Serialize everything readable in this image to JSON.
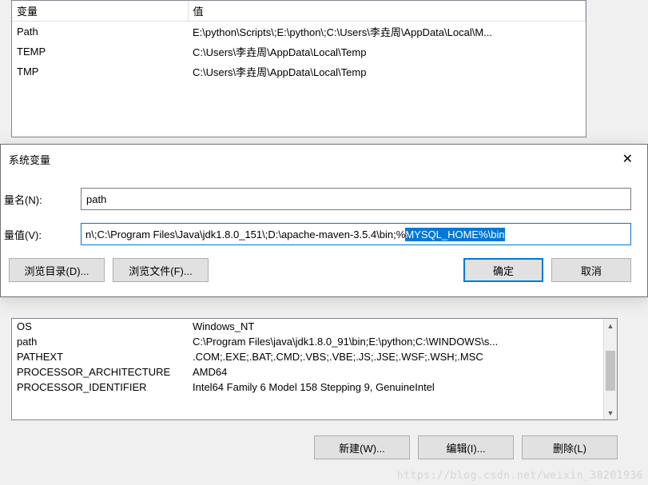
{
  "top_table": {
    "headers": [
      "变量",
      "值"
    ],
    "rows": [
      {
        "var": "Path",
        "val": "E:\\python\\Scripts\\;E:\\python\\;C:\\Users\\李垚周\\AppData\\Local\\M..."
      },
      {
        "var": "TEMP",
        "val": "C:\\Users\\李垚周\\AppData\\Local\\Temp"
      },
      {
        "var": "TMP",
        "val": "C:\\Users\\李垚周\\AppData\\Local\\Temp"
      }
    ]
  },
  "dialog": {
    "title": "系统变量",
    "name_label": "量名(N):",
    "name_value": "path",
    "value_label": "量值(V):",
    "value_plain": "n\\;C:\\Program Files\\Java\\jdk1.8.0_151\\;D:\\apache-maven-3.5.4\\bin;%",
    "value_selected": "MYSQL_HOME%\\bin",
    "browse_dir": "浏览目录(D)...",
    "browse_file": "浏览文件(F)...",
    "ok": "确定",
    "cancel": "取消"
  },
  "bottom_table": {
    "rows": [
      {
        "var": "OS",
        "val": "Windows_NT"
      },
      {
        "var": "path",
        "val": "C:\\Program Files\\java\\jdk1.8.0_91\\bin;E:\\python;C:\\WINDOWS\\s..."
      },
      {
        "var": "PATHEXT",
        "val": ".COM;.EXE;.BAT;.CMD;.VBS;.VBE;.JS;.JSE;.WSF;.WSH;.MSC"
      },
      {
        "var": "PROCESSOR_ARCHITECTURE",
        "val": "AMD64"
      },
      {
        "var": "PROCESSOR_IDENTIFIER",
        "val": "Intel64 Family 6 Model 158 Stepping 9, GenuineIntel"
      }
    ]
  },
  "lower_buttons": {
    "new": "新建(W)...",
    "edit": "编辑(I)...",
    "delete": "删除(L)"
  },
  "watermark": "https://blog.csdn.net/weixin_38201936"
}
